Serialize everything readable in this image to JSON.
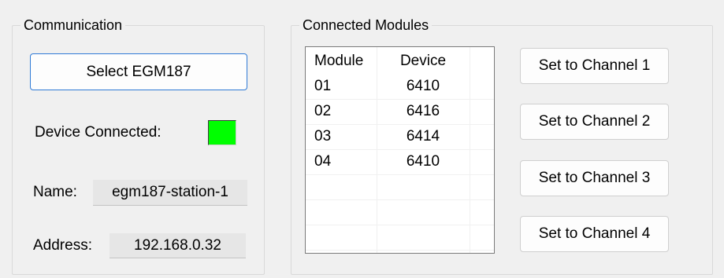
{
  "communication": {
    "title": "Communication",
    "select_button": "Select EGM187",
    "device_connected_label": "Device Connected:",
    "indicator_color": "#00ff00",
    "name_label": "Name:",
    "name_value": "egm187-station-1",
    "address_label": "Address:",
    "address_value": "192.168.0.32"
  },
  "modules": {
    "title": "Connected Modules",
    "columns": [
      "Module",
      "Device"
    ],
    "rows": [
      {
        "module": "01",
        "device": "6410"
      },
      {
        "module": "02",
        "device": "6416"
      },
      {
        "module": "03",
        "device": "6414"
      },
      {
        "module": "04",
        "device": "6410"
      }
    ],
    "buttons": [
      "Set to Channel 1",
      "Set to Channel 2",
      "Set to Channel 3",
      "Set to Channel 4"
    ]
  }
}
